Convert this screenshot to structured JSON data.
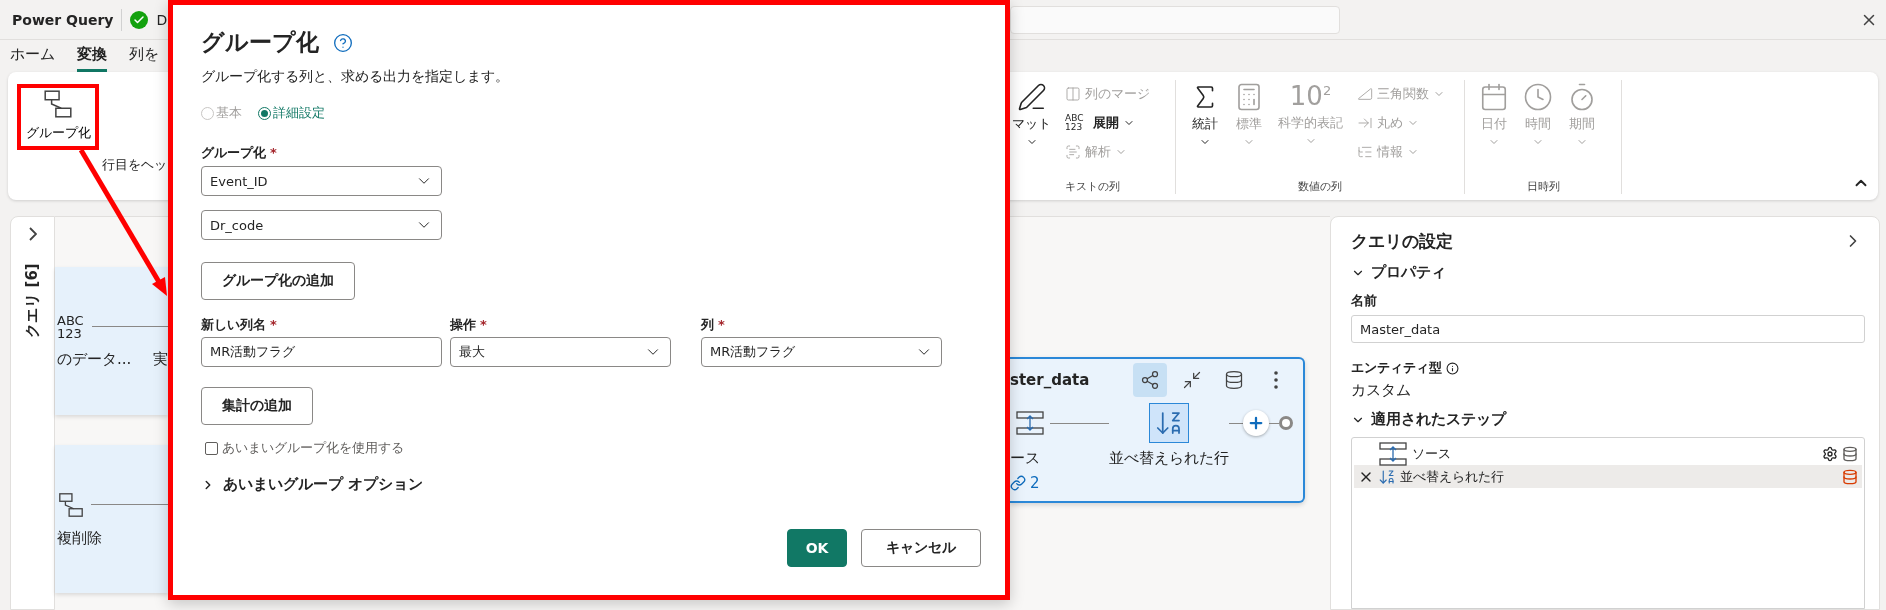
{
  "topbar": {
    "app_title": "Power Query",
    "status": {
      "text": "D",
      "ok": true
    }
  },
  "tabs": [
    {
      "label": "ホーム",
      "selected": false
    },
    {
      "label": "変換",
      "selected": true
    },
    {
      "label": "列を",
      "selected": false
    }
  ],
  "ribbon": {
    "group_by": {
      "label": "グループ化",
      "annotated": true
    },
    "cut_label": "行目をヘッ",
    "collapsed": false,
    "groups": [
      {
        "label": "キストの列",
        "items": [
          {
            "kind": "large",
            "label": "マット",
            "dropdown": true,
            "disabled": false
          },
          {
            "kind": "small",
            "label": "列のマージ",
            "dropdown": false,
            "disabled": true
          },
          {
            "kind": "small",
            "label": "展開",
            "glyph": "ABC 123",
            "dropdown": true,
            "disabled": false
          },
          {
            "kind": "small",
            "label": "解析",
            "dropdown": true,
            "disabled": true
          }
        ]
      },
      {
        "label": "数値の列",
        "items": [
          {
            "kind": "large",
            "label": "統計",
            "dropdown": true,
            "disabled": false
          },
          {
            "kind": "large",
            "label": "標準",
            "dropdown": true,
            "disabled": true
          },
          {
            "kind": "large",
            "label": "科学的表記",
            "glyph": "10$^{2}$",
            "dropdown": true,
            "disabled": true
          },
          {
            "kind": "small",
            "label": "三角関数",
            "dropdown": true,
            "disabled": true
          },
          {
            "kind": "small",
            "label": "丸め",
            "dropdown": true,
            "disabled": true
          },
          {
            "kind": "small",
            "label": "情報",
            "dropdown": true,
            "disabled": true
          }
        ]
      },
      {
        "label": "日時列",
        "items": [
          {
            "kind": "large",
            "label": "日付",
            "dropdown": true,
            "disabled": true
          },
          {
            "kind": "large",
            "label": "時間",
            "dropdown": true,
            "disabled": true
          },
          {
            "kind": "large",
            "label": "期間",
            "dropdown": true,
            "disabled": true
          }
        ]
      }
    ]
  },
  "queries_pane": {
    "label": "クエリ [6]",
    "expanded": false
  },
  "canvas": {
    "cards": [
      {
        "kind": "text",
        "glyph": "ABC 123",
        "label": "のデータ...",
        "label_2": "実"
      },
      {
        "kind": "group",
        "label": "複削除"
      }
    ],
    "query": {
      "title": "ster_data",
      "actions": [
        {
          "selected": true
        },
        {
          "selected": false
        },
        {
          "selected": false
        },
        {
          "selected": false
        }
      ],
      "steps": [
        {
          "label": "ース",
          "selected": false
        },
        {
          "label": "並べ替えられた行",
          "selected": true
        }
      ],
      "link_count": "2"
    }
  },
  "settings": {
    "title": "クエリの設定",
    "properties": {
      "heading": "プロパティ",
      "expanded": true,
      "name_label": "名前",
      "name_value": "Master_data",
      "type_label": "エンティティ型",
      "type_value": "カスタム"
    },
    "steps": {
      "heading": "適用されたステップ",
      "expanded": true,
      "items": [
        {
          "label": "ソース",
          "selected": false
        },
        {
          "label": "並べ替えられた行",
          "selected": true
        }
      ]
    }
  },
  "dialog": {
    "annotated": true,
    "title": "グループ化",
    "description": "グループ化する列と、求める出力を指定します。",
    "modes": [
      {
        "label": "基本",
        "selected": false,
        "disabled": true
      },
      {
        "label": "詳細設定",
        "selected": true,
        "disabled": false
      }
    ],
    "group_by": {
      "label": "グループ化",
      "mark": "*",
      "fields": [
        "Event_ID",
        "Dr_code"
      ]
    },
    "add_grouping": "グループ化の追加",
    "columns": [
      {
        "label": "新しい列名",
        "mark": "*"
      },
      {
        "label": "操作",
        "mark": "*"
      },
      {
        "label": "列",
        "mark": "*"
      }
    ],
    "row": [
      {
        "kind": "input",
        "value": "MR活動フラグ"
      },
      {
        "kind": "select",
        "value": "最大"
      },
      {
        "kind": "select",
        "value": "MR活動フラグ"
      }
    ],
    "add_aggregation": "集計の追加",
    "fuzzy": {
      "label": "あいまいグループ化を使用する",
      "checked": false
    },
    "fuzzy_options": {
      "label": "あいまいグループ オプション",
      "expanded": false
    },
    "buttons": [
      {
        "label": "OK",
        "kind": "primary"
      },
      {
        "label": "キャンセル",
        "kind": "secondary"
      }
    ]
  }
}
